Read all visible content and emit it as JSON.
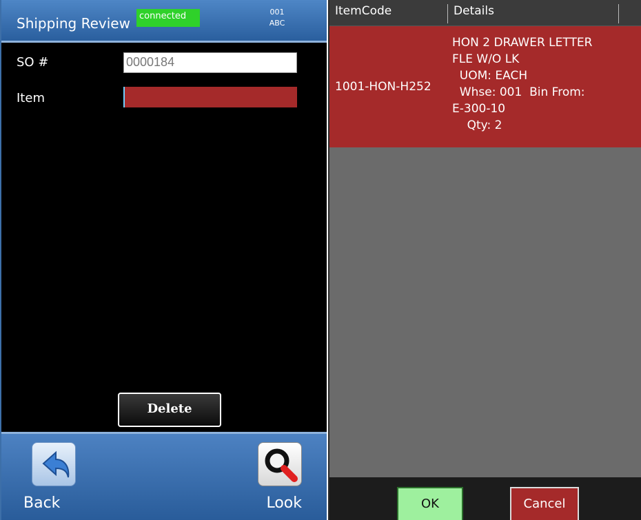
{
  "header": {
    "title": "Shipping Review",
    "connection_status": "connected",
    "code_line1": "001",
    "code_line2": "ABC"
  },
  "form": {
    "so_label": "SO #",
    "so_value": "0000184",
    "item_label": "Item",
    "item_value": ""
  },
  "buttons": {
    "delete_label": "Delete",
    "back_label": "Back",
    "look_label": "Look",
    "ok_label": "OK",
    "cancel_label": "Cancel"
  },
  "icons": {
    "back": "back-arrow-icon",
    "look": "magnifier-icon"
  },
  "grid": {
    "columns": [
      "ItemCode",
      "Details",
      ""
    ],
    "rows": [
      {
        "item_code": "1001-HON-H252",
        "details": "HON 2 DRAWER LETTER\nFLE W/O LK\n  UOM: EACH\n  Whse: 001  Bin From:\nE-300-10\n    Qty: 2"
      }
    ]
  },
  "colors": {
    "title_bar": "#3a72b2",
    "connected": "#2fd12a",
    "selected_row": "#a52a2a",
    "ok": "#9ef09e",
    "cancel": "#a52a2a"
  }
}
